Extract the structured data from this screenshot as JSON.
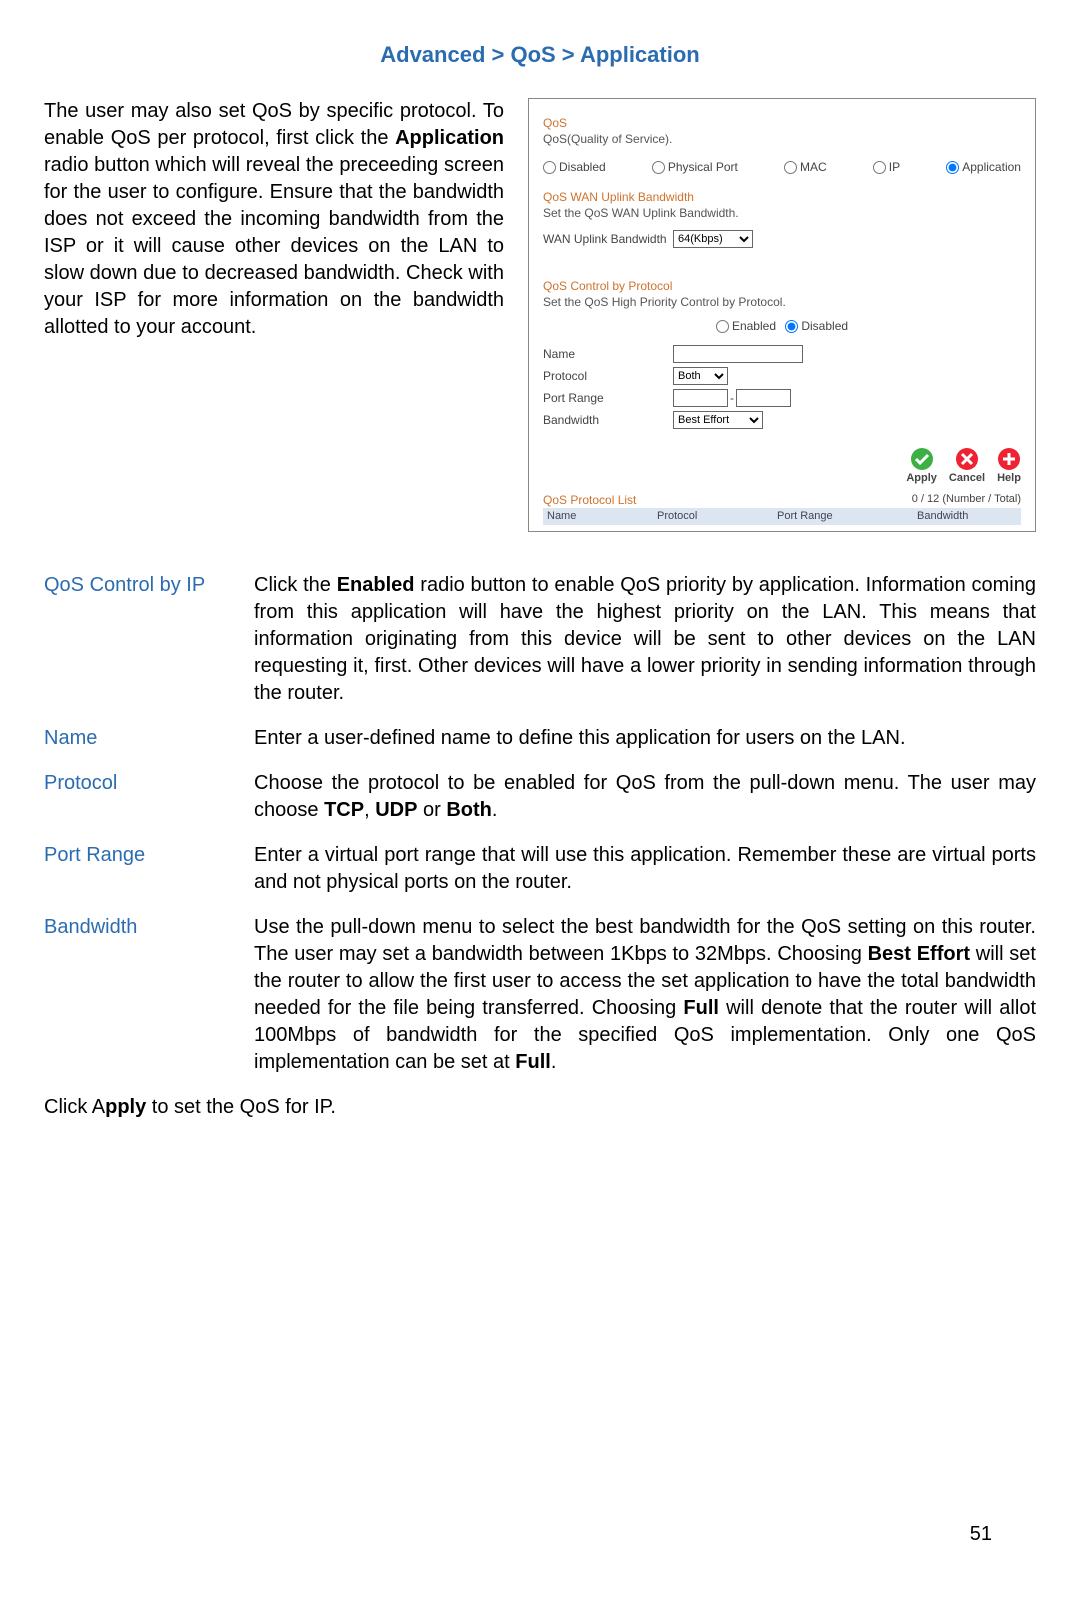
{
  "breadcrumb": "Advanced > QoS > Application",
  "intro_html": "The user may also set QoS by specific protocol. To enable QoS per protocol, first click the <b>Application</b> radio button which will reveal the preceeding screen for the user to configure. Ensure that the bandwidth does not exceed the incoming bandwidth from the ISP or it will cause other devices on the LAN to slow down due to decreased bandwidth. Check with your ISP for more information on the bandwidth allotted to your account.",
  "shot": {
    "title": "QoS",
    "subtitle": "QoS(Quality of Service).",
    "radios": [
      "Disabled",
      "Physical Port",
      "MAC",
      "IP",
      "Application"
    ],
    "radio_selected": "Application",
    "wan_title": "QoS WAN Uplink Bandwidth",
    "wan_sub": "Set the QoS WAN Uplink Bandwidth.",
    "wan_label": "WAN Uplink Bandwidth",
    "wan_select": "64(Kbps)",
    "ctrl_title": "QoS Control by Protocol",
    "ctrl_sub": "Set the QoS High Priority Control by Protocol.",
    "ctrl_enabled": "Enabled",
    "ctrl_disabled": "Disabled",
    "name_label": "Name",
    "protocol_label": "Protocol",
    "protocol_value": "Both",
    "port_label": "Port Range",
    "bw_label": "Bandwidth",
    "bw_value": "Best Effort",
    "btn_apply": "Apply",
    "btn_cancel": "Cancel",
    "btn_help": "Help",
    "list_title": "QoS Protocol List",
    "list_count": "0 / 12 (Number / Total)",
    "cols": [
      "Name",
      "Protocol",
      "Port Range",
      "Bandwidth"
    ]
  },
  "defs": [
    {
      "term": "QoS Control by IP",
      "desc_html": "Click the <b>Enabled</b> radio button to enable QoS priority by application. Information coming from this application will have the highest priority on the LAN. This means that information originating from this device will be sent to other devices on the LAN requesting it, first. Other devices will have a lower priority in sending information through the router."
    },
    {
      "term": "Name",
      "desc_html": "Enter a user-defined name to define this application for users on the LAN."
    },
    {
      "term": "Protocol",
      "desc_html": "Choose the protocol to be enabled for QoS from the pull-down menu. The user may choose <b>TCP</b>, <b>UDP</b> or <b>Both</b>."
    },
    {
      "term": "Port Range",
      "desc_html": "Enter a virtual port range that will use this application. Remember these are virtual ports and not physical ports on the router."
    },
    {
      "term": "Bandwidth",
      "desc_html": "Use the pull-down menu to select the best bandwidth for the QoS setting on this router. The user may set a bandwidth between 1Kbps to 32Mbps. Choosing <b>Best Effort</b> will set the router to allow the first user to access the set application to have the total bandwidth needed for the file being transferred. Choosing <b>Full</b> will denote that the router will allot 100Mbps of bandwidth for the specified QoS implementation. Only one QoS implementation can be set at <b>Full</b>."
    }
  ],
  "foot_html": "Click A<b>pply</b> to set the QoS for IP.",
  "page_number": "51"
}
